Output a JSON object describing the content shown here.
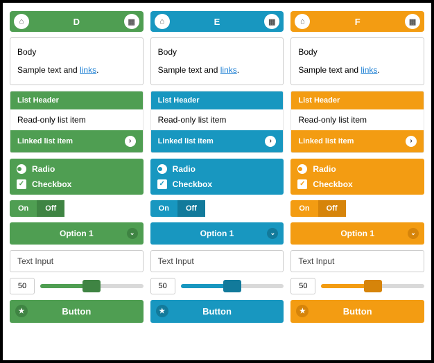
{
  "themes": [
    {
      "id": "D",
      "color": "#4f9e52",
      "dark": "#3f8443"
    },
    {
      "id": "E",
      "color": "#1897c0",
      "dark": "#127a9b"
    },
    {
      "id": "F",
      "color": "#f39c12",
      "dark": "#d6840a"
    }
  ],
  "bar_title": [
    "D",
    "E",
    "F"
  ],
  "body": {
    "heading": "Body",
    "text_prefix": "Sample text and ",
    "link": "links",
    "text_suffix": "."
  },
  "list": {
    "header": "List Header",
    "readonly": "Read-only list item",
    "linked": "Linked list item"
  },
  "controls": {
    "radio": "Radio",
    "checkbox": "Checkbox"
  },
  "toggle": {
    "on": "On",
    "off": "Off"
  },
  "select": {
    "value": "Option 1"
  },
  "input": {
    "placeholder": "Text Input"
  },
  "slider": {
    "value": "50"
  },
  "button": {
    "label": "Button"
  }
}
